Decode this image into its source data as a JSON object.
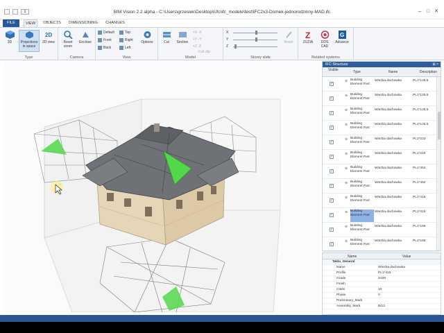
{
  "window": {
    "title": "BIM Vision 2.2 alpha - C:\\Users\\grzesiek\\Desktop\\Ufc\\ifc_modele\\test\\IFC2x3-Domek-jednorodzinny-MAD.ifc",
    "quick_value": "1",
    "min_label": "–",
    "max_label": "□",
    "close_label": "✕"
  },
  "tabs": [
    "FILE",
    "VIEW",
    "OBJECTS",
    "DIMENSIONING",
    "CHANGES"
  ],
  "ribbon": {
    "type_group": {
      "label": "Type",
      "btn_3d": "3D",
      "btn_projection": "Projections in space",
      "btn_2d": "2D view"
    },
    "camera_group": {
      "label": "Camera",
      "btn_reset": "Reset zoom",
      "btn_enclose": "Enclose"
    },
    "view_group": {
      "label": "View",
      "items": [
        "Default",
        "Front",
        "Back",
        "Top",
        "Right",
        "Left"
      ],
      "btn_options": "Options"
    },
    "model_group": {
      "label": "Model",
      "btn_cut": "Cut",
      "btn_section": "Section",
      "clip_rows": [
        "+X -X",
        "+Y -Y",
        "+Z -Z"
      ],
      "full_clip": "Full clip"
    },
    "storey_group": {
      "label": "Storey slide",
      "axes": [
        "X",
        "Y",
        "Z"
      ],
      "btn_reset": "Reset"
    },
    "related_group": {
      "label": "Related systems",
      "btn_zuzia": "ZUZIA",
      "btn_dds": "DDS CAD",
      "btn_advance": "Advance"
    }
  },
  "ifc_structure": {
    "title": "IFC Structure",
    "pin": "⊞ ×",
    "columns": {
      "visible": "Visible",
      "type": "Type",
      "name": "Name",
      "description": "Description"
    },
    "rows": [
      {
        "visible": true,
        "type": "Building Element Part",
        "name": "Wiezba dachowka",
        "description": "PL1*125.5",
        "selected": false
      },
      {
        "visible": true,
        "type": "Building Element Part",
        "name": "Wiezba dachowka",
        "description": "PL1*125.5",
        "selected": false
      },
      {
        "visible": true,
        "type": "Building Element Part",
        "name": "Wiezba dachowka",
        "description": "PL1*125.5",
        "selected": false
      },
      {
        "visible": true,
        "type": "Building Element Part",
        "name": "Wiezba dachowka",
        "description": "PL1*125.5",
        "selected": false
      },
      {
        "visible": true,
        "type": "Building Element Part",
        "name": "Wiezba dachowka",
        "description": "PL1*223",
        "selected": false
      },
      {
        "visible": true,
        "type": "Building Element Part",
        "name": "Wiezba dachowka",
        "description": "PL1*223",
        "selected": false
      },
      {
        "visible": true,
        "type": "Building Element Part",
        "name": "Wiezba dachowka",
        "description": "PL1*452",
        "selected": false
      },
      {
        "visible": true,
        "type": "Building Element Part",
        "name": "Wiezba dachowka",
        "description": "PL1*452",
        "selected": false
      },
      {
        "visible": true,
        "type": "Building Element Part",
        "name": "Wiezba dachowka",
        "description": "PL1*416",
        "selected": false
      },
      {
        "visible": true,
        "type": "Building Element Part",
        "name": "Wiezba dachowka",
        "description": "PL1*416",
        "selected": true
      },
      {
        "visible": true,
        "type": "Building Element Part",
        "name": "Wiezba dachowka",
        "description": "PL1*185",
        "selected": false
      },
      {
        "visible": true,
        "type": "Building Element Part",
        "name": "Wiezba dachowka",
        "description": "PL1*185",
        "selected": false
      }
    ]
  },
  "properties": {
    "columns": {
      "name": "Name",
      "value": "Value"
    },
    "group": "Tekla_General",
    "rows": [
      {
        "name": "Name",
        "value": "Wiezba dachowka"
      },
      {
        "name": "Profile",
        "value": "PL1*416"
      },
      {
        "name": "Grade",
        "value": "S320"
      },
      {
        "name": "Finish",
        "value": ""
      },
      {
        "name": "Class",
        "value": "10"
      },
      {
        "name": "Phase",
        "value": "0"
      },
      {
        "name": "Preliminary_Mark",
        "value": ""
      },
      {
        "name": "Assembly_Mark",
        "value": "B/12"
      }
    ]
  },
  "colors": {
    "accent": "#2b5797",
    "highlight": "#52d84a",
    "selection": "#8fb3e6",
    "roof": "#6e7277",
    "wall": "#e6d6b8"
  },
  "icons": [
    "cube-icon",
    "projection-icon",
    "2d-icon",
    "zoom-icon",
    "enclose-icon",
    "options-gear-icon",
    "cut-icon",
    "section-icon",
    "reset-icon",
    "zuzia-icon",
    "dds-icon",
    "advance-icon"
  ]
}
